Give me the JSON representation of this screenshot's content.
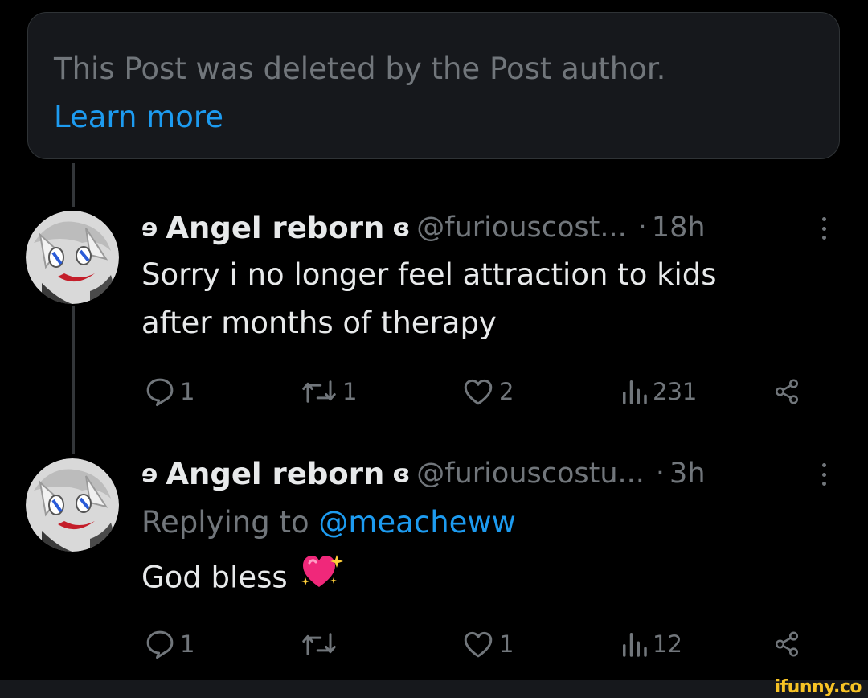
{
  "deleted_notice": {
    "text": "This Post was deleted by the Post author.",
    "link": "Learn more"
  },
  "posts": [
    {
      "name_prefix": "ɘ",
      "name": "Angel reborn",
      "name_suffix": "ɞ",
      "handle": "@furiouscost...",
      "separator": "·",
      "time": "18h",
      "body_lines": [
        "Sorry i no longer feel attraction to kids",
        "after months of therapy"
      ],
      "actions": {
        "replies": "1",
        "reposts": "1",
        "likes": "2",
        "views": "231"
      }
    },
    {
      "name_prefix": "ɘ",
      "name": "Angel reborn",
      "name_suffix": "ɞ",
      "handle": "@furiouscostu...",
      "separator": "·",
      "time": "3h",
      "replying_prefix": "Replying to",
      "replying_to": "@meacheww",
      "body_text": "God bless",
      "body_emoji": "💖",
      "actions": {
        "replies": "1",
        "reposts": "",
        "likes": "1",
        "views": "12"
      }
    }
  ],
  "watermark": "ifunny.co",
  "colors": {
    "background": "#000000",
    "card": "#16181c",
    "text": "#e7e9ea",
    "muted": "#71767b",
    "accent": "#1d9bf0",
    "heart": "#f91880"
  },
  "icons": [
    "reply-icon",
    "repost-icon",
    "like-icon",
    "views-icon",
    "share-icon",
    "more-icon"
  ]
}
